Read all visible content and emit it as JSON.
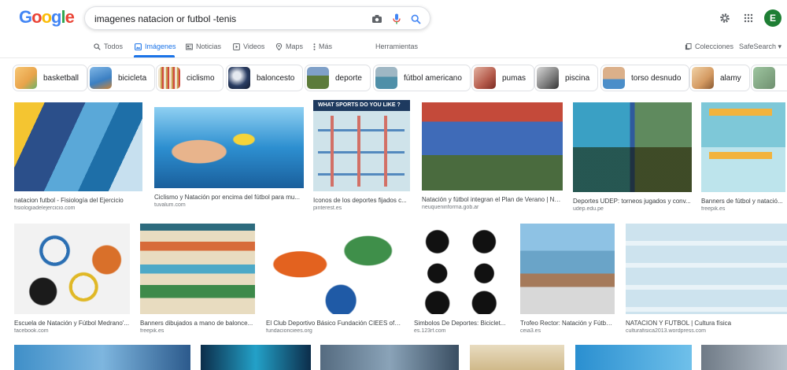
{
  "logo_text": "Google",
  "search": {
    "query": "imagenes natacion or futbol -tenis"
  },
  "icons": {
    "camera": "camera-icon",
    "mic": "mic-icon",
    "search": "search-icon",
    "settings": "gear-icon",
    "apps": "apps-grid-icon"
  },
  "account": {
    "initial": "E"
  },
  "tabs": [
    {
      "label": "Todos"
    },
    {
      "label": "Imágenes"
    },
    {
      "label": "Noticias"
    },
    {
      "label": "Videos"
    },
    {
      "label": "Maps"
    },
    {
      "label": "Más"
    },
    {
      "label": "Herramientas"
    }
  ],
  "right_tools": {
    "collections": "Colecciones",
    "safesearch": "SafeSearch ▾"
  },
  "chips": [
    {
      "label": "basketball",
      "color": "#e8a34a"
    },
    {
      "label": "bicicleta",
      "color": "#3b7fc2"
    },
    {
      "label": "ciclismo",
      "color": "#c99a4e"
    },
    {
      "label": "baloncesto",
      "color": "#2a3d63"
    },
    {
      "label": "deporte",
      "color": "#5c7b3a"
    },
    {
      "label": "fútbol americano",
      "color": "#4f8fa8"
    },
    {
      "label": "pumas",
      "color": "#b45a4b"
    },
    {
      "label": "piscina",
      "color": "#7a7a7a"
    },
    {
      "label": "torso desnudo",
      "color": "#4b8ec9"
    },
    {
      "label": "alamy",
      "color": "#d49a62"
    }
  ],
  "results": [
    {
      "title": "natacion futbol - Fisiología del Ejercicio",
      "source": "fisiologiadelejercicio.com",
      "color": "#3a6ea5"
    },
    {
      "title": "Ciclismo y Natación por encima del fútbol para mu...",
      "source": "tuvalum.com",
      "color": "#2d8fd0"
    },
    {
      "title": "Iconos de los deportes fijados c...",
      "source": "pinterest.es",
      "color": "#cfe3ea"
    },
    {
      "title": "Natación y fútbol integran el Plan de Verano | Ne...",
      "source": "neuqueninforma.gob.ar",
      "color": "#4a6b3e"
    },
    {
      "title": "Deportes UDEP: torneos jugados y conv...",
      "source": "udep.edu.pe",
      "color": "#5f8a5e"
    },
    {
      "title": "Banners de fútbol y natació...",
      "source": "freepik.es",
      "color": "#7ec8d8"
    },
    {
      "title": "Escuela de Natación y Fútbol Medrano'...",
      "source": "facebook.com",
      "color": "#f2f2f2"
    },
    {
      "title": "Banners dibujados a mano de balonce...",
      "source": "freepik.es",
      "color": "#e8dcc0"
    },
    {
      "title": "El Club Deportivo Básico Fundación CIEES ofer...",
      "source": "fundacionciees.org",
      "color": "#ffffff"
    },
    {
      "title": "Simbolos De Deportes: Biciclet...",
      "source": "es.123rf.com",
      "color": "#ffffff"
    },
    {
      "title": "Trofeo Rector: Natación y Fútbo...",
      "source": "ceia3.es",
      "color": "#6aa4c8"
    },
    {
      "title": "NATACION Y FUTBOL | Cultura física",
      "source": "culturafisica2013.wordpress.com",
      "color": "#cde3ee"
    }
  ]
}
